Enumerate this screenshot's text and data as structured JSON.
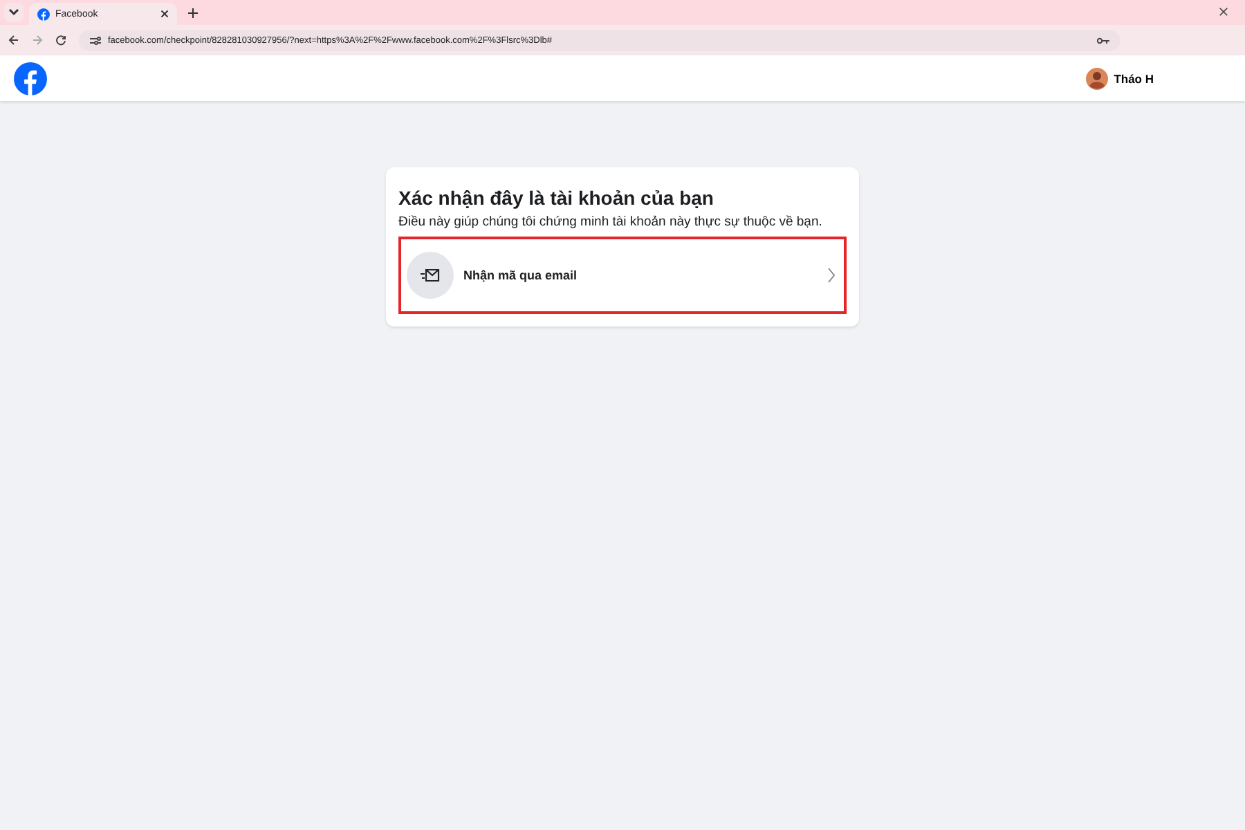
{
  "browser": {
    "tabs": [
      {
        "title": "Facebook",
        "selected": true
      }
    ],
    "url": "facebook.com/checkpoint/828281030927956/?next=https%3A%2F%2Fwww.facebook.com%2F%3Flsrc%3Dlb#"
  },
  "header": {
    "profile_name": "Tháo H"
  },
  "card": {
    "title": "Xác nhận đây là tài khoản của bạn",
    "subtitle": "Điều này giúp chúng tôi chứng minh tài khoản này thực sự thuộc về bạn.",
    "options": [
      {
        "label": "Nhận mã qua email",
        "highlighted": true
      }
    ]
  }
}
